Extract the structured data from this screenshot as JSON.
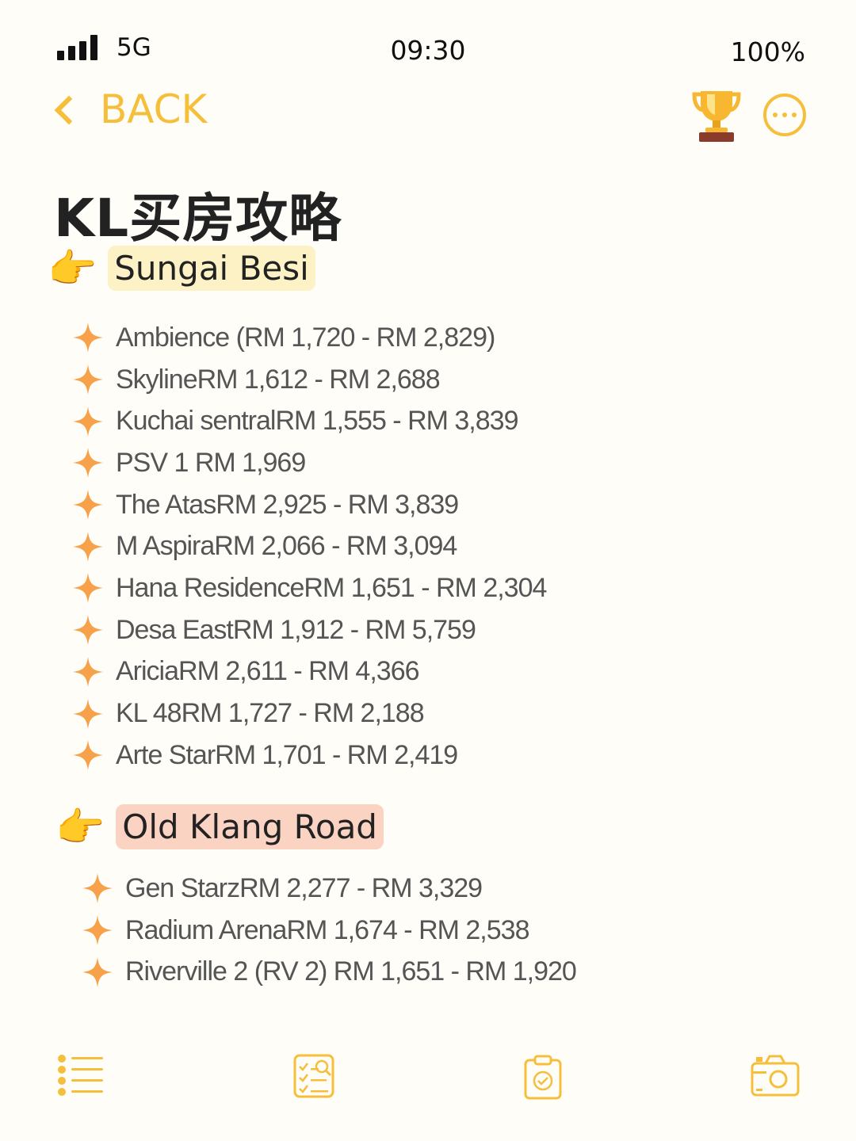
{
  "status": {
    "network": "5G",
    "time": "09:30",
    "battery": "100%"
  },
  "nav": {
    "back_label": "BACK",
    "trophy_icon": "trophy-icon",
    "more_icon": "more-icon"
  },
  "title": "KL买房攻略",
  "sections": [
    {
      "heading": "Sungai Besi",
      "pointer": "👉",
      "highlight": "#fdf1c6",
      "items": [
        "Ambience (RM 1,720 - RM 2,829)",
        "SkylineRM 1,612 - RM 2,688",
        "Kuchai sentralRM 1,555 - RM 3,839",
        "PSV 1 RM 1,969",
        "The AtasRM 2,925 - RM 3,839",
        "M AspiraRM 2,066 - RM 3,094",
        "Hana ResidenceRM 1,651 - RM 2,304",
        "Desa EastRM 1,912 - RM 5,759",
        "AriciaRM 2,611 - RM 4,366",
        "KL 48RM 1,727 - RM 2,188",
        "Arte StarRM 1,701 - RM 2,419"
      ]
    },
    {
      "heading": "Old Klang Road",
      "pointer": "👉",
      "highlight": "#fbd3c2",
      "items": [
        "Gen StarzRM 2,277 - RM 3,329",
        "Radium ArenaRM 1,674 - RM 2,538",
        "Riverville 2 (RV 2) RM 1,651 - RM 1,920"
      ]
    }
  ],
  "toolbar": [
    "list-icon",
    "checklist-search-icon",
    "clipboard-check-icon",
    "camera-icon"
  ],
  "colors": {
    "accent": "#f5bf3c",
    "star": "#f7a24a",
    "background": "#fefdf8"
  }
}
